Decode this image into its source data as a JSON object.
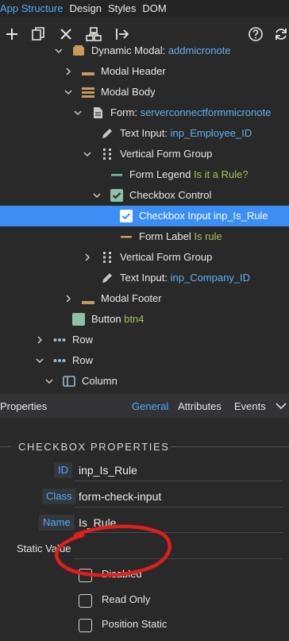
{
  "top_tabs": [
    "App Structure",
    "Design",
    "Styles",
    "DOM"
  ],
  "toolbar": {
    "icons": [
      "add-icon",
      "copy-icon",
      "delete-icon",
      "structure-icon",
      "move-out-icon",
      "help-icon",
      "refresh-icon"
    ]
  },
  "tree": {
    "items": [
      {
        "name": "Dynamic Modal:",
        "sub": "addmicronote",
        "icon": "modal-icon"
      },
      {
        "name": "Modal Header",
        "sub": "",
        "icon": "header-icon"
      },
      {
        "name": "Modal Body",
        "sub": "",
        "icon": "body-icon"
      },
      {
        "name": "Form:",
        "sub": "serverconnectformmicronote",
        "icon": "form-icon"
      },
      {
        "name": "Text Input:",
        "sub": "inp_Employee_ID",
        "icon": "text-input-icon"
      },
      {
        "name": "Vertical Form Group",
        "sub": "",
        "icon": "form-group-icon"
      },
      {
        "name": "Form Legend",
        "sub": "Is it a Rule?",
        "icon": "legend-icon"
      },
      {
        "name": "Checkbox Control",
        "sub": "",
        "icon": "checkbox-control-icon"
      },
      {
        "name": "Checkbox Input",
        "sub": "inp_Is_Rule",
        "icon": "checkbox-input-icon"
      },
      {
        "name": "Form Label",
        "sub": "Is rule",
        "icon": "label-icon"
      },
      {
        "name": "Vertical Form Group",
        "sub": "",
        "icon": "form-group-icon"
      },
      {
        "name": "Text Input:",
        "sub": "inp_Company_ID",
        "icon": "text-input-icon"
      },
      {
        "name": "Modal Footer",
        "sub": "",
        "icon": "footer-icon"
      },
      {
        "name": "Button",
        "sub": "btn4",
        "icon": "button-icon"
      },
      {
        "name": "Row",
        "sub": "",
        "icon": "row-icon"
      },
      {
        "name": "Row",
        "sub": "",
        "icon": "row-icon"
      },
      {
        "name": "Column",
        "sub": "",
        "icon": "column-icon"
      }
    ]
  },
  "properties": {
    "title": "Properties",
    "tabs": [
      "General",
      "Attributes",
      "Events"
    ],
    "active_tab": "General",
    "section": "CHECKBOX PROPERTIES",
    "fields": {
      "id_label": "ID",
      "id_value": "inp_Is_Rule",
      "class_label": "Class",
      "class_value": "form-check-input",
      "name_label": "Name",
      "name_value": "Is_Rule",
      "static_value_label": "Static Value",
      "static_value": ""
    },
    "checkboxes": [
      {
        "label": "Disabled",
        "checked": false
      },
      {
        "label": "Read Only",
        "checked": false
      },
      {
        "label": "Position Static",
        "checked": false
      }
    ]
  },
  "colors": {
    "accent": "#3a8ef6",
    "link": "#4ea9ff",
    "annotation": "#e31c1c"
  }
}
